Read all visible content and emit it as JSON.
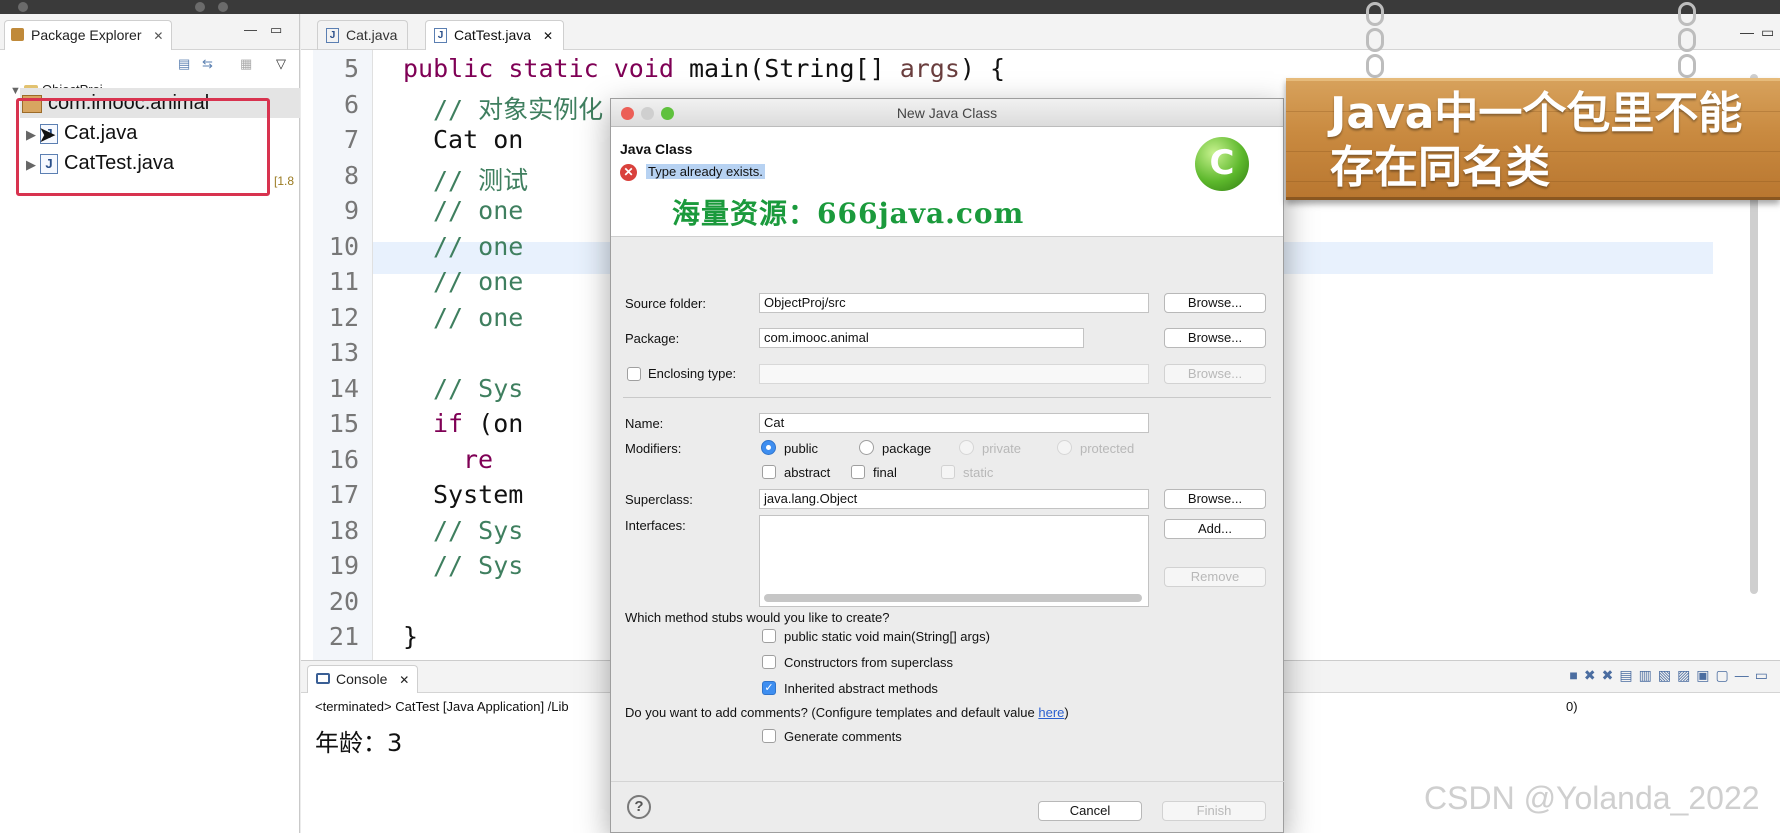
{
  "package_explorer": {
    "tab_label": "Package Explorer",
    "project": "ObjectProj",
    "package": "com.imooc.animal",
    "files": [
      "Cat.java",
      "CatTest.java"
    ],
    "jre_suffix": "[1.8"
  },
  "editor": {
    "tabs": [
      "Cat.java",
      "CatTest.java"
    ],
    "line_numbers": [
      "5",
      "6",
      "7",
      "8",
      "9",
      "10",
      "11",
      "12",
      "13",
      "14",
      "15",
      "16",
      "17",
      "18",
      "19",
      "20",
      "21"
    ],
    "lines": [
      {
        "kw": "public static void ",
        "text": "main(String[] ",
        "param": "args",
        "tail": ") {"
      },
      {
        "comment": "// 对象实例化"
      },
      {
        "text": "Cat on"
      },
      {
        "comment": "// 测试"
      },
      {
        "comment": "// one"
      },
      {
        "comment": "// one"
      },
      {
        "comment": "// one"
      },
      {
        "comment": "// one"
      },
      {
        "text": ""
      },
      {
        "comment": "// Sys"
      },
      {
        "kw": "if ",
        "text": "(on"
      },
      {
        "kw": "re",
        "text": ""
      },
      {
        "text": "System"
      },
      {
        "comment": "// Sys"
      },
      {
        "comment": "// Sys"
      },
      {
        "text": ""
      },
      {
        "text": "}"
      }
    ]
  },
  "console": {
    "tab_label": "Console",
    "status_left": "<terminated> CatTest [Java Application] /Lib",
    "status_right": "0)",
    "output": "年龄：3"
  },
  "dialog": {
    "window_title": "New Java Class",
    "header_title": "Java Class",
    "error_message": "Type already exists.",
    "logo_letter": "C",
    "source_folder": {
      "label": "Source folder:",
      "value": "ObjectProj/src",
      "button": "Browse..."
    },
    "package": {
      "label": "Package:",
      "value": "com.imooc.animal",
      "button": "Browse..."
    },
    "enclosing": {
      "label": "Enclosing type:",
      "value": "",
      "button": "Browse..."
    },
    "name": {
      "label": "Name:",
      "value": "Cat"
    },
    "modifiers": {
      "label": "Modifiers:",
      "radios": [
        "public",
        "package",
        "private",
        "protected"
      ],
      "checks": [
        "abstract",
        "final",
        "static"
      ]
    },
    "superclass": {
      "label": "Superclass:",
      "value": "java.lang.Object",
      "button": "Browse..."
    },
    "interfaces": {
      "label": "Interfaces:",
      "add_button": "Add...",
      "remove_button": "Remove"
    },
    "stubs": {
      "question": "Which method stubs would you like to create?",
      "items": [
        "public static void main(String[] args)",
        "Constructors from superclass",
        "Inherited abstract methods"
      ]
    },
    "comments": {
      "question_prefix": "Do you want to add comments? (Configure templates and default value ",
      "link": "here",
      "question_suffix": ")",
      "option": "Generate comments"
    },
    "cancel": "Cancel",
    "finish": "Finish"
  },
  "overlay": {
    "sign_line1": "Java中一个包里不能",
    "sign_line2": "存在同名类",
    "watermark": "海量资源：666java.com",
    "csdn": "CSDN @Yolanda_2022"
  },
  "colors": {
    "keyword": "#7f0055",
    "comment": "#3f7f5f",
    "highlight": "#e8f1fd",
    "red_box": "#d8334f",
    "selected_blue": "#3e8ef0"
  }
}
